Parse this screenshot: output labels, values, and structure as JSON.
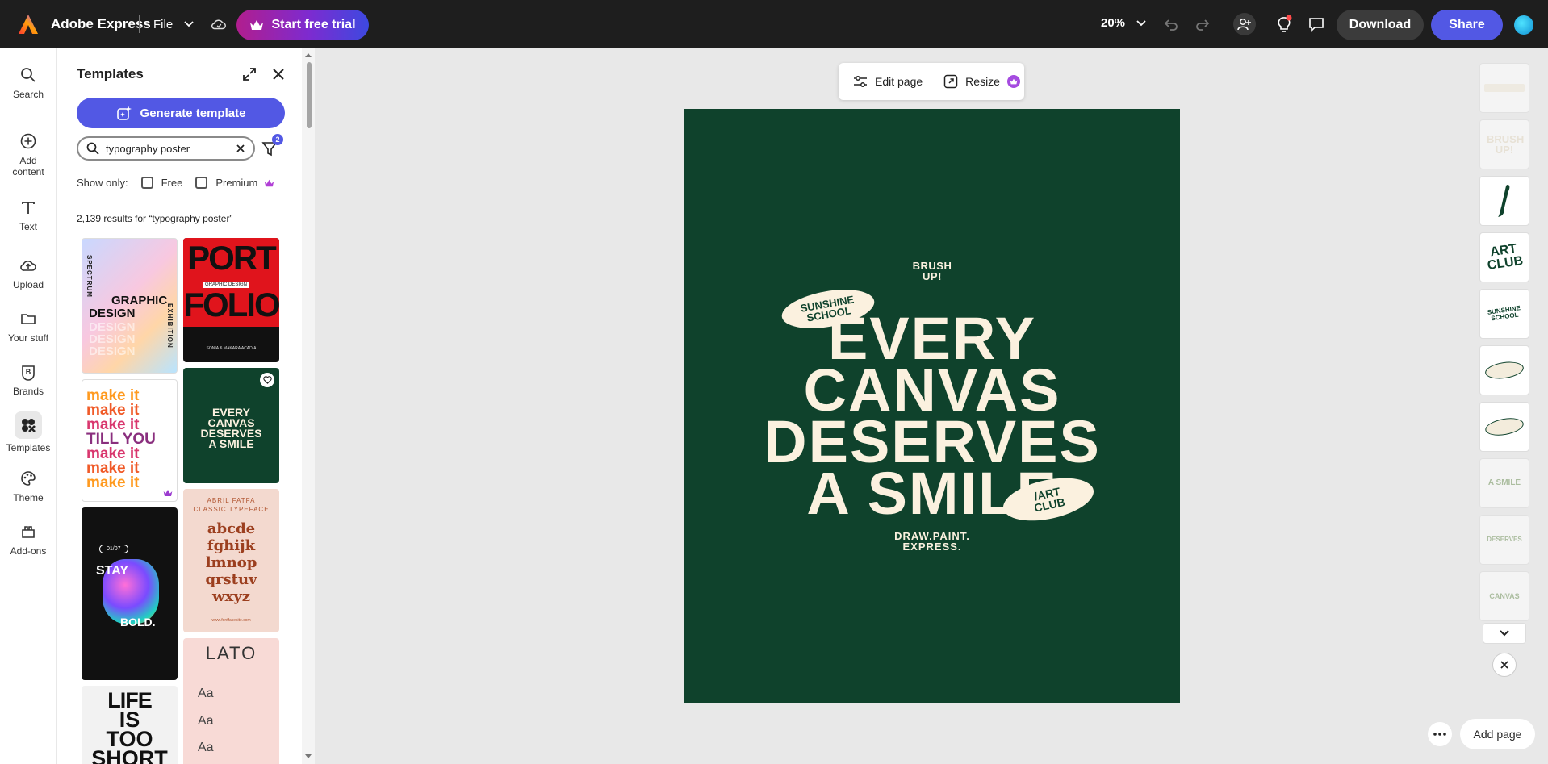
{
  "topbar": {
    "app_name": "Adobe Express",
    "file_label": "File",
    "trial_label": "Start free trial",
    "zoom": "20%",
    "download_label": "Download",
    "share_label": "Share"
  },
  "rail": {
    "items": [
      {
        "label": "Search",
        "icon": "search-icon"
      },
      {
        "label": "Add content",
        "icon": "plus-circle-icon"
      },
      {
        "label": "Text",
        "icon": "text-icon"
      },
      {
        "label": "Upload",
        "icon": "upload-icon"
      },
      {
        "label": "Your stuff",
        "icon": "folder-icon"
      },
      {
        "label": "Brands",
        "icon": "brands-icon"
      },
      {
        "label": "Templates",
        "icon": "templates-icon"
      },
      {
        "label": "Theme",
        "icon": "palette-icon"
      },
      {
        "label": "Add-ons",
        "icon": "addons-icon"
      }
    ]
  },
  "panel": {
    "title": "Templates",
    "generate_label": "Generate template",
    "search_value": "typography poster",
    "filter_count": "2",
    "show_only_label": "Show only:",
    "free_label": "Free",
    "premium_label": "Premium",
    "results_text": "2,139 results for “typography poster”",
    "tiles": {
      "t1": {
        "l1": "SPECTRUM",
        "l2": "GRAPHIC",
        "l3": "DESIGN",
        "l4": "EXHIBITION"
      },
      "t2": {
        "l1": "PORT",
        "l2": "FOLIO",
        "l3": "GRAPHIC DESIGN",
        "l4": "SONIA & MAKARA ACADIA"
      },
      "t3": {
        "lines": [
          "make it",
          "make it",
          "make it",
          "TILL YOU",
          "make it",
          "make it",
          "make it"
        ]
      },
      "t4": {
        "l1": "EVERY",
        "l2": "CANVAS",
        "l3": "DESERVES",
        "l4": "A SMILE"
      },
      "t5": {
        "l1": "STAY",
        "l2": "BOLD.",
        "l3": "01/07"
      },
      "t6": {
        "l1": "ABRIL FATFA",
        "l2": "CLASSIC TYPEFACE",
        "lines": [
          "abcde",
          "fghijk",
          "lmnop",
          "qrstuv",
          "wxyz"
        ],
        "l3": "www.fontfacesite.com"
      },
      "t7": {
        "l1": "LIFE",
        "l2": "IS",
        "l3": "TOO",
        "l4": "SHORT"
      },
      "t8": {
        "l1": "LATO",
        "l2": "Aa",
        "l3": "Aa",
        "l4": "Aa"
      }
    }
  },
  "page_toolbar": {
    "edit_label": "Edit page",
    "resize_label": "Resize"
  },
  "poster": {
    "top": "BRUSH\nUP!",
    "badge_left": "SUNSHINE\nSCHOOL",
    "line1": "EVERY",
    "line2": "CANVAS",
    "line3": "DESERVES",
    "line4": "A SMILE",
    "badge_right": "/ART\nCLUB",
    "bottom": "DRAW.PAINT.\nEXPRESS."
  },
  "layers": {
    "items": [
      "BRUSH UP!",
      "ART CLUB",
      "SUNSHINE SCHOOL",
      "A SMILE",
      "DESERVES",
      "CANVAS"
    ]
  },
  "bottom": {
    "add_page_label": "Add page"
  },
  "colors": {
    "accent": "#5258e4",
    "poster_bg": "#0f422c",
    "poster_ink": "#fbf1df"
  }
}
